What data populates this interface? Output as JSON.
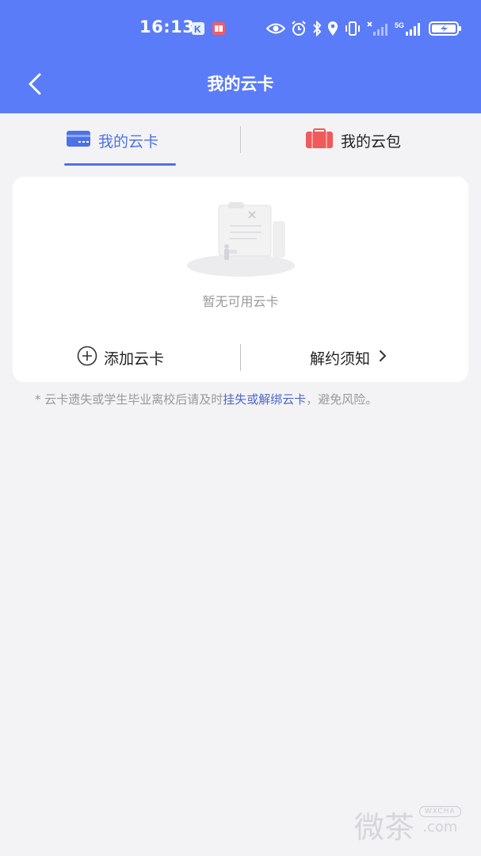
{
  "status_bar": {
    "time": "16:13",
    "network": "5G",
    "icons": [
      "k-app-icon",
      "book-app-icon",
      "eye-icon",
      "alarm-icon",
      "bluetooth-icon",
      "location-icon",
      "vibrate-icon",
      "wifi-off-signal-icon",
      "signal-icon",
      "battery-charging-icon"
    ]
  },
  "nav": {
    "title": "我的云卡",
    "back_icon": "chevron-left-icon"
  },
  "tabs": [
    {
      "label": "我的云卡",
      "icon": "card-icon",
      "active": true
    },
    {
      "label": "我的云包",
      "icon": "wallet-icon",
      "active": false
    }
  ],
  "card_panel": {
    "empty_text": "暂无可用云卡",
    "add_label": "添加云卡",
    "terms_label": "解约须知"
  },
  "notice": {
    "prefix": "* 云卡遗失或学生毕业离校后请及时",
    "link": "挂失或解绑云卡",
    "suffix": "，避免风险。"
  },
  "watermark": {
    "text": "微茶",
    "badge": "WXCHA",
    "domain": ".com"
  },
  "colors": {
    "header": "#5a7cf8",
    "accent": "#4d72e6",
    "wallet_icon": "#f05a5a",
    "background": "#f3f3f6"
  }
}
